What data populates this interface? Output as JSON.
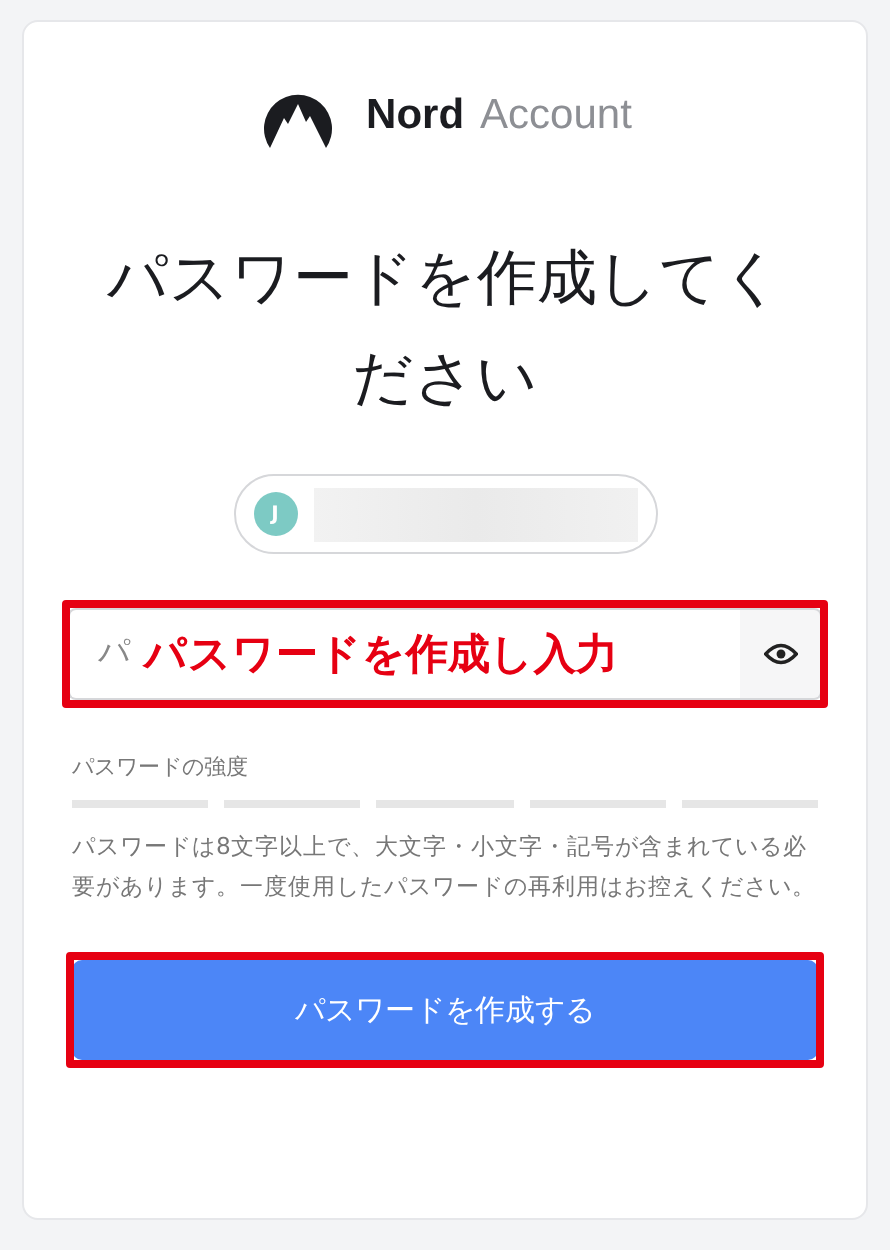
{
  "brand": {
    "name": "Nord",
    "product": "Account"
  },
  "heading": "パスワードを作成してください",
  "account": {
    "initial": "J"
  },
  "password_field": {
    "placeholder": "パ"
  },
  "strength": {
    "label": "パスワードの強度"
  },
  "hint": "パスワードは8文字以上で、大文字・小文字・記号が含まれている必要があります。一度使用したパスワードの再利用はお控えください。",
  "submit": "パスワードを作成する",
  "annotation": {
    "text": "パスワードを作成し入力"
  }
}
